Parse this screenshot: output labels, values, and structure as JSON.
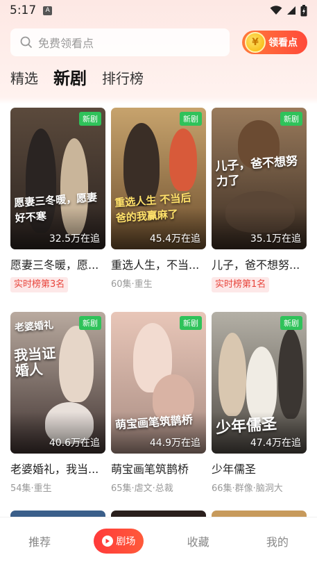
{
  "status_bar": {
    "time": "5:17",
    "notif_letter": "A"
  },
  "search": {
    "placeholder": "免费领看点",
    "reward_label": "领看点",
    "coin_symbol": "¥"
  },
  "tabs": [
    {
      "label": "精选",
      "active": false
    },
    {
      "label": "新剧",
      "active": true
    },
    {
      "label": "排行榜",
      "active": false
    }
  ],
  "dramas": [
    {
      "title": "愿妻三冬暖，愿...",
      "art_title": "愿妻三冬暖，愿妻好不寒",
      "badge": "新剧",
      "heat": "32.5万在追",
      "rank": "实时榜第3名",
      "colors": [
        "#5b4a3c",
        "#2b2320"
      ]
    },
    {
      "title": "重选人生，不当...",
      "art_title": "重选人生 不当后爸的我赢麻了",
      "badge": "新剧",
      "heat": "45.4万在追",
      "meta": "60集·重生",
      "colors": [
        "#c7a36d",
        "#6d4f2e"
      ]
    },
    {
      "title": "儿子，爸不想努...",
      "art_title": "儿子，爸不想努力了",
      "badge": "新剧",
      "heat": "35.1万在追",
      "rank": "实时榜第1名",
      "colors": [
        "#9a7b5c",
        "#3a2c22"
      ]
    },
    {
      "title": "老婆婚礼，我当...",
      "art_title": "我当证婚人",
      "art_top": "老婆婚礼",
      "badge": "新剧",
      "heat": "40.6万在追",
      "meta": "54集·重生",
      "colors": [
        "#b9aa9f",
        "#403331"
      ]
    },
    {
      "title": "萌宝画笔筑鹊桥",
      "art_title": "萌宝画笔筑鹊桥",
      "badge": "新剧",
      "heat": "44.9万在追",
      "meta": "65集·虐文·总裁",
      "colors": [
        "#e8c6b8",
        "#a88c82"
      ]
    },
    {
      "title": "少年儒圣",
      "art_title": "少年儒圣",
      "badge": "新剧",
      "heat": "47.4万在追",
      "meta": "66集·群像·脑洞大",
      "colors": [
        "#b4b0a6",
        "#4f4a44"
      ]
    }
  ],
  "bottom_nav": [
    {
      "label": "推荐",
      "active": false
    },
    {
      "label": "剧场",
      "active": true
    },
    {
      "label": "收藏",
      "active": false
    },
    {
      "label": "我的",
      "active": false
    }
  ]
}
